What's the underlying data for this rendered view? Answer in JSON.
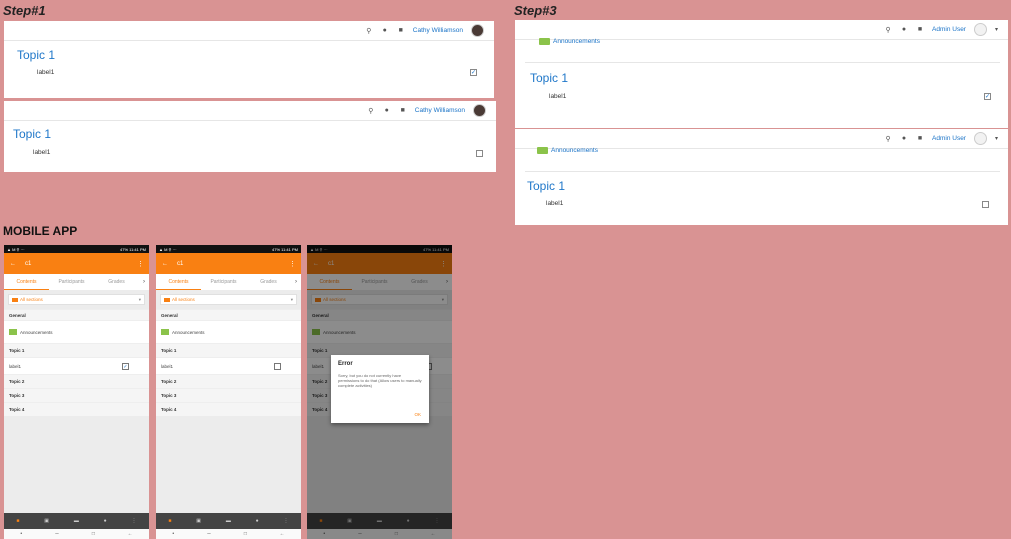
{
  "labels": {
    "step1": "Step#1",
    "step3": "Step#3",
    "mobile": "MOBILE APP"
  },
  "step1": {
    "user": "Cathy Williamson",
    "panels": [
      {
        "topic": "Topic 1",
        "item": "label1",
        "checked": true
      },
      {
        "topic": "Topic 1",
        "item": "label1",
        "checked": false
      }
    ]
  },
  "step3": {
    "user": "Admin User",
    "panels": [
      {
        "announcements": "Announcements",
        "topic": "Topic 1",
        "item": "label1",
        "checked": true
      },
      {
        "announcements": "Announcements",
        "topic": "Topic 1",
        "item": "label1",
        "checked": false
      }
    ]
  },
  "mobile": {
    "status_right": "47% 11:41 PM",
    "course": "c1",
    "tabs": [
      "Contents",
      "Participants",
      "Grades"
    ],
    "sections_select": "All sections",
    "general": "General",
    "announcements": "Announcements",
    "topics": [
      "Topic 1",
      "Topic 2",
      "Topic 3",
      "Topic 4"
    ],
    "item": "label1",
    "error": {
      "title": "Error",
      "message": "Sorry, but you do not currently have permissions to do that (Allow users to manually complete activities)",
      "ok": "OK"
    }
  },
  "icons": {
    "search": "search-icon",
    "bell": "bell-icon",
    "chat": "chat-icon",
    "check": "checkmark-icon"
  },
  "colors": {
    "accent": "#f98012",
    "link": "#1f77c9",
    "background": "#d99393"
  }
}
